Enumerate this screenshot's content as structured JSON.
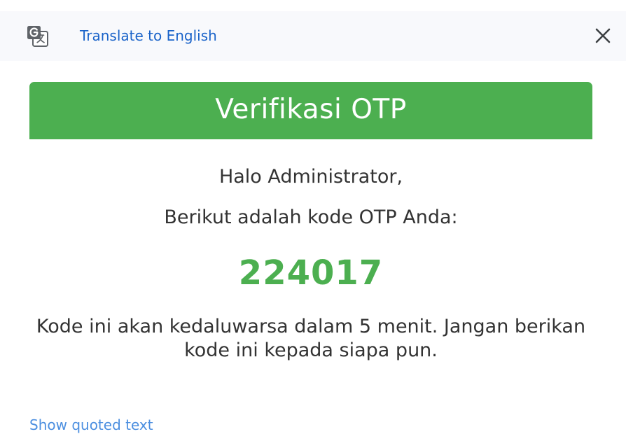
{
  "translate_bar": {
    "icon": "translate-icon",
    "link_label": "Translate to English",
    "close_icon": "close-icon"
  },
  "email": {
    "header_title": "Verifikasi OTP",
    "greeting": "Halo Administrator,",
    "intro": "Berikut adalah kode OTP Anda:",
    "otp_code": "224017",
    "expiry_notice": "Kode ini akan kedaluwarsa dalam 5 menit. Jangan berikan kode ini kepada siapa pun."
  },
  "footer": {
    "show_quoted_label": "Show quoted text"
  },
  "colors": {
    "brand_green": "#4caf50",
    "link_blue": "#1a63c9",
    "quoted_link_blue": "#4c8fe0",
    "bar_background": "#f8f9fc",
    "body_text": "#333333"
  }
}
